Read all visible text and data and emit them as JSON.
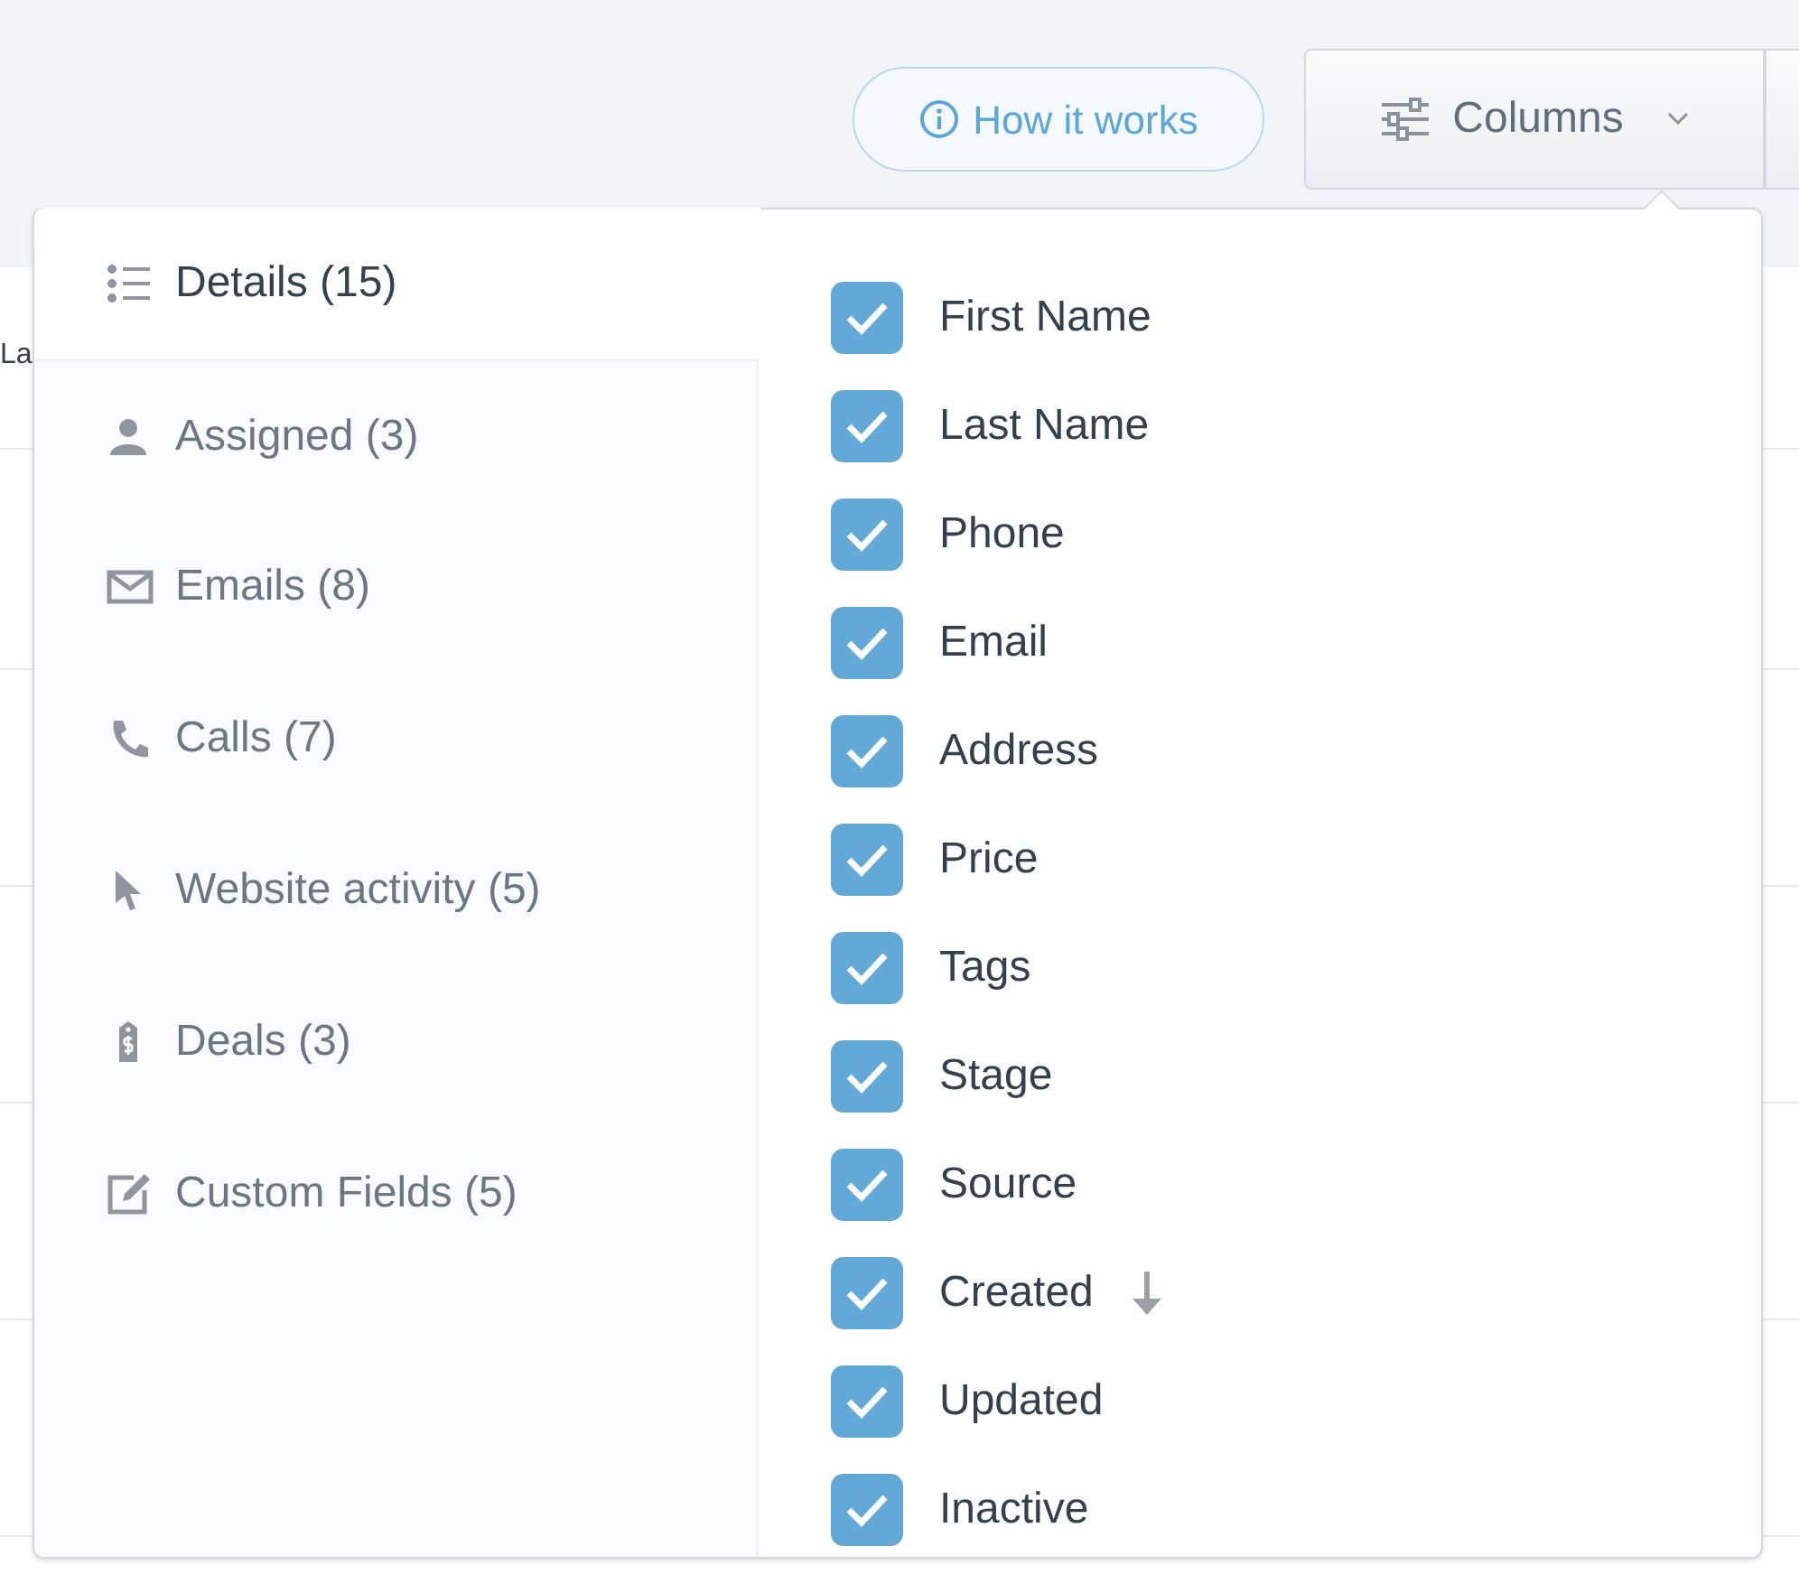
{
  "background_table": {
    "header_cell": "La"
  },
  "toolbar": {
    "help_button": {
      "label": "How it works"
    },
    "columns_button": {
      "label": "Columns",
      "expanded": true
    }
  },
  "columns_menu": {
    "categories": [
      {
        "label": "Details (15)",
        "kind": "list",
        "selected": true
      },
      {
        "label": "Assigned (3)",
        "kind": "person",
        "selected": false
      },
      {
        "label": "Emails (8)",
        "kind": "mail",
        "selected": false
      },
      {
        "label": "Calls (7)",
        "kind": "phone",
        "selected": false
      },
      {
        "label": "Website activity (5)",
        "kind": "cursor",
        "selected": false
      },
      {
        "label": "Deals (3)",
        "kind": "tag",
        "selected": false
      },
      {
        "label": "Custom Fields (5)",
        "kind": "edit",
        "selected": false
      }
    ],
    "fields": [
      {
        "label": "First Name",
        "checked": true
      },
      {
        "label": "Last Name",
        "checked": true
      },
      {
        "label": "Phone",
        "checked": true
      },
      {
        "label": "Email",
        "checked": true
      },
      {
        "label": "Address",
        "checked": true
      },
      {
        "label": "Price",
        "checked": true
      },
      {
        "label": "Tags",
        "checked": true
      },
      {
        "label": "Stage",
        "checked": true
      },
      {
        "label": "Source",
        "checked": true
      },
      {
        "label": "Created",
        "checked": true,
        "sort_descending": true
      },
      {
        "label": "Updated",
        "checked": true
      },
      {
        "label": "Inactive",
        "checked": true
      }
    ]
  }
}
